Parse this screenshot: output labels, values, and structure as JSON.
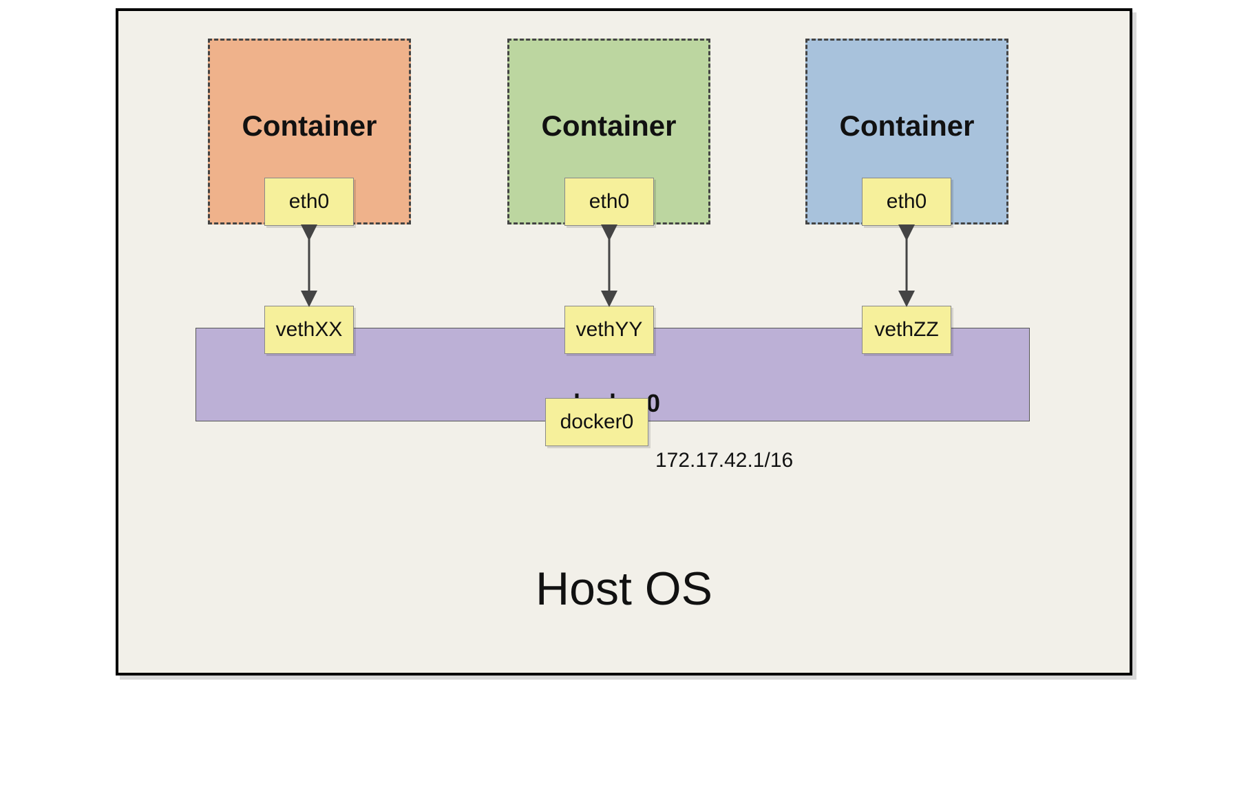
{
  "host_os_label": "Host OS",
  "bridge": {
    "title": "docker0",
    "interface_label": "docker0",
    "ip": "172.17.42.1/16"
  },
  "containers": [
    {
      "title": "Container",
      "eth_label": "eth0",
      "veth_label": "vethXX",
      "color": "#efb28b"
    },
    {
      "title": "Container",
      "eth_label": "eth0",
      "veth_label": "vethYY",
      "color": "#bcd6a0"
    },
    {
      "title": "Container",
      "eth_label": "eth0",
      "veth_label": "vethZZ",
      "color": "#a8c2dc"
    }
  ]
}
